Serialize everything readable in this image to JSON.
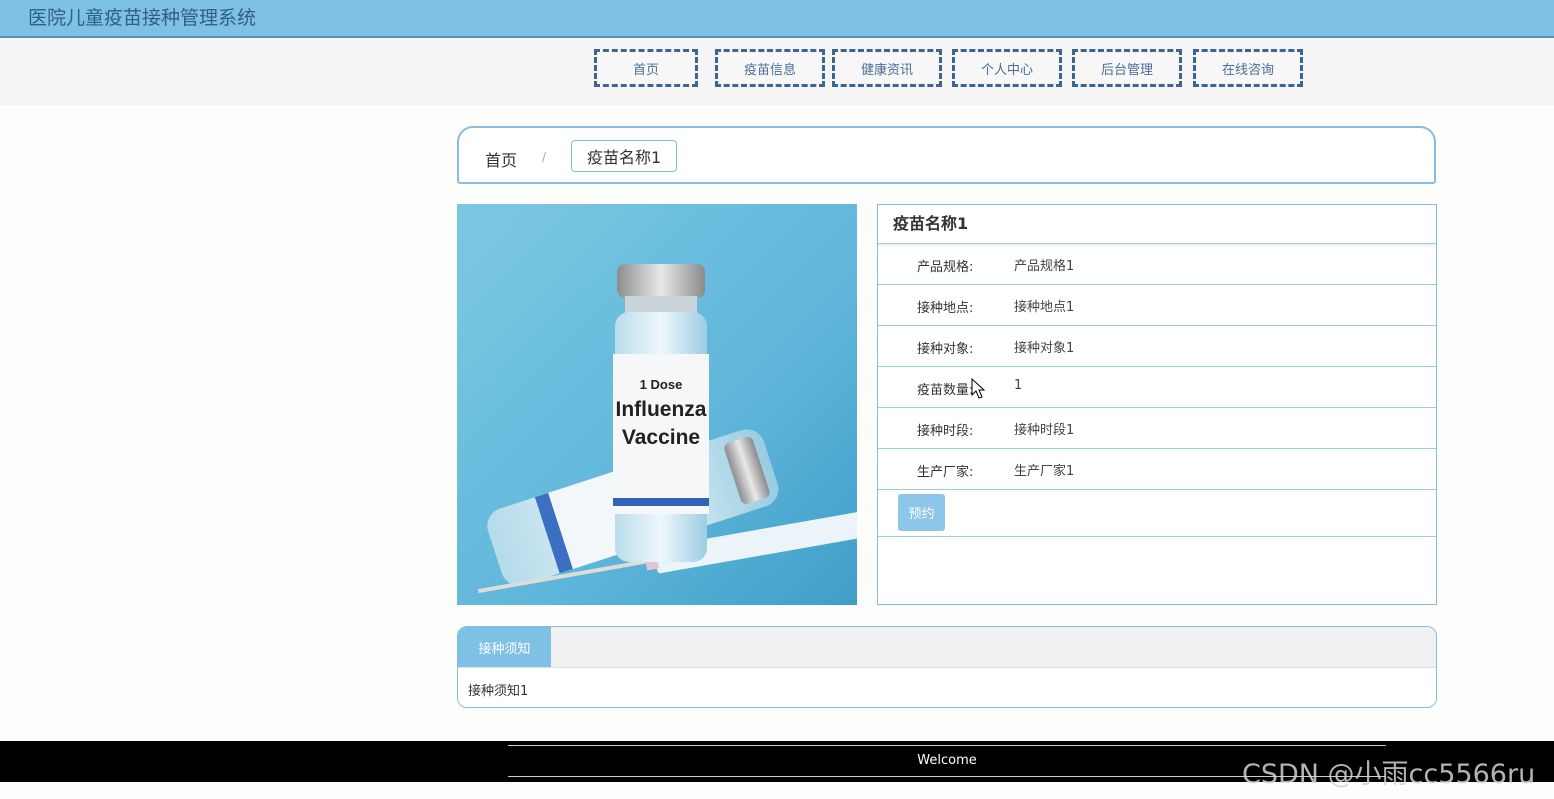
{
  "header": {
    "title": "医院儿童疫苗接种管理系统"
  },
  "nav": {
    "items": [
      {
        "label": "首页"
      },
      {
        "label": "疫苗信息"
      },
      {
        "label": "健康资讯"
      },
      {
        "label": "个人中心"
      },
      {
        "label": "后台管理"
      },
      {
        "label": "在线咨询"
      }
    ]
  },
  "breadcrumb": {
    "home": "首页",
    "separator": "/",
    "current": "疫苗名称1"
  },
  "product": {
    "image": {
      "line1": "1 Dose",
      "line2": "Influenza",
      "line3": "Vaccine"
    },
    "title": "疫苗名称1",
    "fields": [
      {
        "label": "产品规格:",
        "value": "产品规格1"
      },
      {
        "label": "接种地点:",
        "value": "接种地点1"
      },
      {
        "label": "接种对象:",
        "value": "接种对象1"
      },
      {
        "label": "疫苗数量:",
        "value": "1"
      },
      {
        "label": "接种时段:",
        "value": "接种时段1"
      },
      {
        "label": "生产厂家:",
        "value": "生产厂家1"
      }
    ],
    "book_button": "预约"
  },
  "notice": {
    "tab": "接种须知",
    "content": "接种须知1"
  },
  "footer": {
    "text": "Welcome"
  },
  "watermark": "CSDN @小雨cc5566ru",
  "colors": {
    "accent": "#7fc0e5",
    "border": "#86bce0",
    "nav_border": "#3d6493",
    "footer_bg": "#000000"
  }
}
